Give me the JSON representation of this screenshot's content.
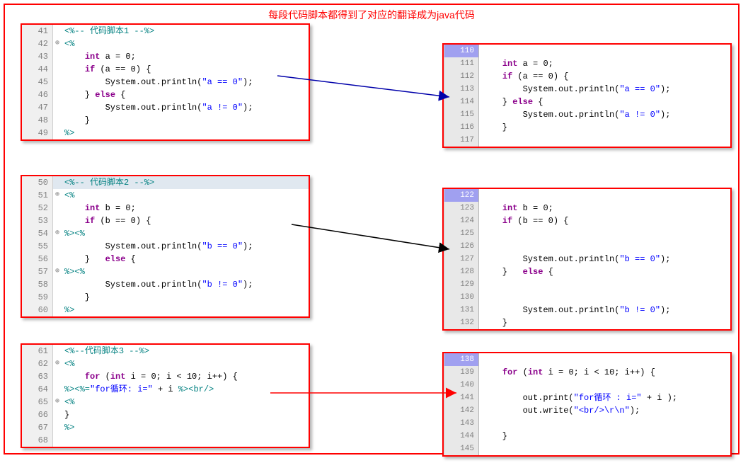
{
  "title": "每段代码脚本都得到了对应的翻译成为java代码",
  "box1_left": {
    "lines": [
      {
        "num": "41",
        "marker": "",
        "html": "<span class='tag'>&lt;%--</span> <span class='cmt'>代码脚本1 </span><span class='tag'>--%&gt;</span>"
      },
      {
        "num": "42",
        "marker": "⊕",
        "html": "<span class='tag'>&lt;%</span>"
      },
      {
        "num": "43",
        "marker": "",
        "html": "    <span class='kw'>int</span> a = 0;"
      },
      {
        "num": "44",
        "marker": "",
        "html": "    <span class='kw'>if</span> (a == 0) {"
      },
      {
        "num": "45",
        "marker": "",
        "html": "        System.out.println(<span class='str'>\"a == 0\"</span>);"
      },
      {
        "num": "46",
        "marker": "",
        "html": "    } <span class='kw'>else</span> {"
      },
      {
        "num": "47",
        "marker": "",
        "html": "        System.out.println(<span class='str'>\"a != 0\"</span>);"
      },
      {
        "num": "48",
        "marker": "",
        "html": "    }"
      },
      {
        "num": "49",
        "marker": "",
        "html": "<span class='tag'>%&gt;</span>"
      }
    ]
  },
  "box1_right": {
    "lines": [
      {
        "num": "110",
        "hl": true,
        "html": ""
      },
      {
        "num": "111",
        "html": "    <span class='kw2'>int</span> a = <span class='num'>0</span>;"
      },
      {
        "num": "112",
        "html": "    <span class='kw2'>if</span> (a == <span class='num'>0</span>) {"
      },
      {
        "num": "113",
        "html": "        System.out.println(<span class='str'>\"a == 0\"</span>);"
      },
      {
        "num": "114",
        "html": "    } <span class='kw2'>else</span> {"
      },
      {
        "num": "115",
        "html": "        System.out.println(<span class='str'>\"a != 0\"</span>);"
      },
      {
        "num": "116",
        "html": "    }"
      },
      {
        "num": "117",
        "html": ""
      }
    ]
  },
  "box2_left": {
    "lines": [
      {
        "num": "50",
        "marker": "",
        "sel": true,
        "html": "<span class='tag'>&lt;%--</span> <span class='cmt'>代码脚本2 </span><span class='tag'>--%&gt;</span>"
      },
      {
        "num": "51",
        "marker": "⊕",
        "html": "<span class='tag'>&lt;%</span>"
      },
      {
        "num": "52",
        "marker": "",
        "html": "    <span class='kw'>int</span> b = 0;"
      },
      {
        "num": "53",
        "marker": "",
        "html": "    <span class='kw'>if</span> (b == 0) {"
      },
      {
        "num": "54",
        "marker": "⊕",
        "html": "<span class='tag'>%&gt;&lt;%</span>"
      },
      {
        "num": "55",
        "marker": "",
        "html": "        System.out.println(<span class='str'>\"b == 0\"</span>);"
      },
      {
        "num": "56",
        "marker": "",
        "html": "    }   <span class='kw'>else</span> {"
      },
      {
        "num": "57",
        "marker": "⊕",
        "html": "<span class='tag'>%&gt;&lt;%</span>"
      },
      {
        "num": "58",
        "marker": "",
        "html": "        System.out.println(<span class='str'>\"b != 0\"</span>);"
      },
      {
        "num": "59",
        "marker": "",
        "html": "    }"
      },
      {
        "num": "60",
        "marker": "",
        "html": "<span class='tag'>%&gt;</span>"
      }
    ]
  },
  "box2_right": {
    "lines": [
      {
        "num": "122",
        "hl": true,
        "html": ""
      },
      {
        "num": "123",
        "html": "    <span class='kw2'>int</span> b = <span class='num'>0</span>;"
      },
      {
        "num": "124",
        "html": "    <span class='kw2'>if</span> (b == <span class='num'>0</span>) {"
      },
      {
        "num": "125",
        "html": ""
      },
      {
        "num": "126",
        "html": ""
      },
      {
        "num": "127",
        "html": "        System.out.println(<span class='str'>\"b == 0\"</span>);"
      },
      {
        "num": "128",
        "html": "    }   <span class='kw2'>else</span> {"
      },
      {
        "num": "129",
        "html": ""
      },
      {
        "num": "130",
        "html": ""
      },
      {
        "num": "131",
        "html": "        System.out.println(<span class='str'>\"b != 0\"</span>);"
      },
      {
        "num": "132",
        "html": "    }"
      }
    ]
  },
  "box3_left": {
    "lines": [
      {
        "num": "61",
        "marker": "",
        "html": "<span class='tag'>&lt;%--</span><span class='cmt'>代码脚本3 </span><span class='tag'>--%&gt;</span>"
      },
      {
        "num": "62",
        "marker": "⊕",
        "html": "<span class='tag'>&lt;%</span>"
      },
      {
        "num": "63",
        "marker": "",
        "html": "    <span class='kw'>for</span> (<span class='kw'>int</span> i = 0; i &lt; 10; i++) {"
      },
      {
        "num": "64",
        "marker": "",
        "html": "<span class='tag'>%&gt;&lt;%=</span><span class='str'>\"for循环: i=\"</span> + i <span class='tag'>%&gt;</span><span class='tag'>&lt;br/&gt;</span>"
      },
      {
        "num": "65",
        "marker": "⊕",
        "html": "<span class='tag'>&lt;%</span>"
      },
      {
        "num": "66",
        "marker": "",
        "html": "}"
      },
      {
        "num": "67",
        "marker": "",
        "html": "<span class='tag'>%&gt;</span>"
      },
      {
        "num": "68",
        "marker": "",
        "html": ""
      }
    ]
  },
  "box3_right": {
    "lines": [
      {
        "num": "138",
        "hl": true,
        "html": ""
      },
      {
        "num": "139",
        "html": "    <span class='kw2'>for</span> (<span class='kw2'>int</span> i = <span class='num'>0</span>; i &lt; <span class='num'>10</span>; i++) {"
      },
      {
        "num": "140",
        "html": ""
      },
      {
        "num": "141",
        "html": "        out.print(<span class='str'>\"for循环 : i=\"</span> + i );"
      },
      {
        "num": "142",
        "html": "        out.write(<span class='str'>\"&lt;br/&gt;\\r\\n\"</span>);"
      },
      {
        "num": "143",
        "html": ""
      },
      {
        "num": "144",
        "html": "    }"
      },
      {
        "num": "145",
        "html": ""
      }
    ]
  }
}
